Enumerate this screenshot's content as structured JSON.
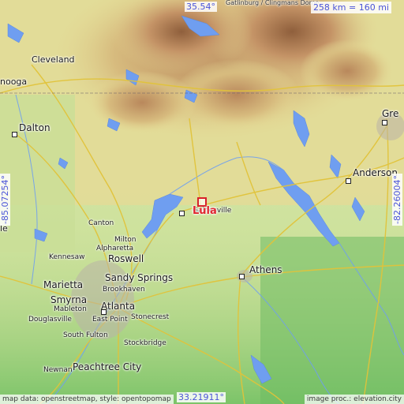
{
  "map": {
    "scale_label": "258 km = 160 mi",
    "coords": {
      "top": "35.54°",
      "bottom": "33.21911°",
      "left": "-85.07254°",
      "right": "-82.26004°"
    },
    "attribution_left": "map data: openstreetmap, style: opentopomap",
    "attribution_right": "image proc.: elevation.city",
    "marker_label": "Lula",
    "colors": {
      "water": "#6f9ef0",
      "lowland": "#a8d68a",
      "midland": "#e7e09a",
      "highland": "#c79a6a",
      "peak": "#9e6e46",
      "marker": "#d8202a",
      "coord_text": "#4a54d8"
    },
    "places": [
      {
        "name": "Cleveland",
        "size": "mid"
      },
      {
        "name": "nooga",
        "size": "mid"
      },
      {
        "name": "Dalton",
        "size": "big"
      },
      {
        "name": "Gre",
        "size": "big"
      },
      {
        "name": "Anderson",
        "size": "big"
      },
      {
        "name": "Canton",
        "size": "sm"
      },
      {
        "name": "Milton",
        "size": "sm"
      },
      {
        "name": "Alpharetta",
        "size": "sm"
      },
      {
        "name": "Roswell",
        "size": "big"
      },
      {
        "name": "Kennesaw",
        "size": "sm"
      },
      {
        "name": "Marietta",
        "size": "big"
      },
      {
        "name": "Sandy Springs",
        "size": "big"
      },
      {
        "name": "Brookhaven",
        "size": "sm"
      },
      {
        "name": "Smyrna",
        "size": "big"
      },
      {
        "name": "Mableton",
        "size": "sm"
      },
      {
        "name": "Atlanta",
        "size": "big"
      },
      {
        "name": "Douglasville",
        "size": "sm"
      },
      {
        "name": "East Point",
        "size": "sm"
      },
      {
        "name": "Stonecrest",
        "size": "sm"
      },
      {
        "name": "South Fulton",
        "size": "sm"
      },
      {
        "name": "Stockbridge",
        "size": "sm"
      },
      {
        "name": "Newnan",
        "size": "sm"
      },
      {
        "name": "Peachtree City",
        "size": "big"
      },
      {
        "name": "Athens",
        "size": "big"
      },
      {
        "name": "Gainesville",
        "size": "sm"
      },
      {
        "name": "Gatlinburg / Clingmans Dome",
        "size": "tiny"
      },
      {
        "name": "le",
        "size": "mid"
      }
    ]
  }
}
